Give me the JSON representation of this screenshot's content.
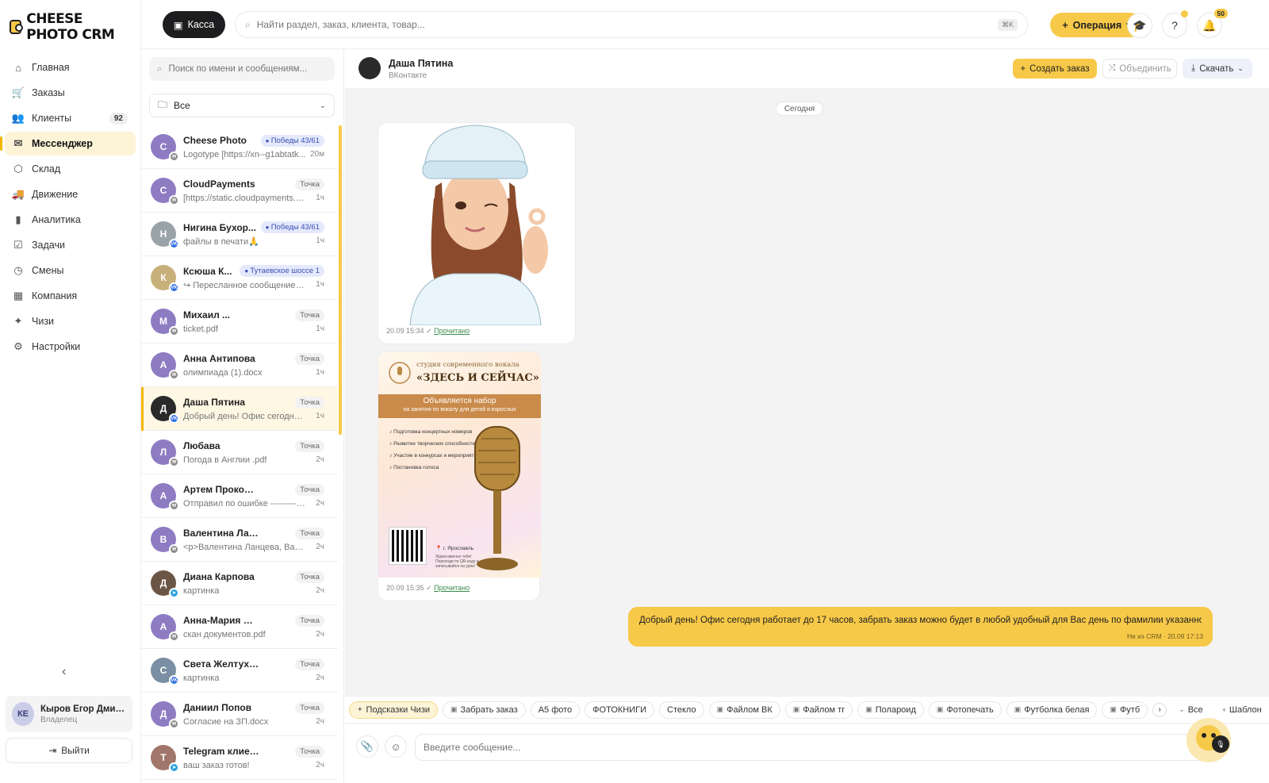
{
  "app": {
    "logo": "CHEESE PHOTO CRM"
  },
  "sidebar": {
    "items": [
      {
        "label": "Главная",
        "icon": "home-icon",
        "glyph": "⌂"
      },
      {
        "label": "Заказы",
        "icon": "cart-icon",
        "glyph": "🛒"
      },
      {
        "label": "Клиенты",
        "icon": "users-icon",
        "glyph": "👥",
        "badge": "92"
      },
      {
        "label": "Мессенджер",
        "icon": "mail-icon",
        "glyph": "✉",
        "active": true
      },
      {
        "label": "Склад",
        "icon": "box-icon",
        "glyph": "⬡"
      },
      {
        "label": "Движение",
        "icon": "truck-icon",
        "glyph": "🚚"
      },
      {
        "label": "Аналитика",
        "icon": "chart-icon",
        "glyph": "▮"
      },
      {
        "label": "Задачи",
        "icon": "clipboard-icon",
        "glyph": "☑"
      },
      {
        "label": "Смены",
        "icon": "clock-icon",
        "glyph": "◷"
      },
      {
        "label": "Компания",
        "icon": "building-icon",
        "glyph": "▦"
      },
      {
        "label": "Чизи",
        "icon": "sparkle-icon",
        "glyph": "✦"
      },
      {
        "label": "Настройки",
        "icon": "gear-icon",
        "glyph": "⚙"
      }
    ],
    "user": {
      "initials": "КЕ",
      "name": "Кыров Егор Дмитр...",
      "role": "Владелец"
    },
    "logout": "Выйти"
  },
  "topbar": {
    "kassa": "Касса",
    "search_placeholder": "Найти раздел, заказ, клиента, товар...",
    "shortcut": "⌘K",
    "operation": "Операция",
    "notifications": "50"
  },
  "chatlist": {
    "search_placeholder": "Поиск по имени и сообщениям...",
    "filter": "Все",
    "items": [
      {
        "initial": "C",
        "color": "#8e7cc3",
        "channel": "mail",
        "name": "Cheese Photo",
        "tag": "Победы 43/61",
        "tag_type": "blue",
        "preview": "Logotype [https://xn--g1abtatk...",
        "time": "20м"
      },
      {
        "initial": "C",
        "color": "#8e7cc3",
        "channel": "mail",
        "name": "CloudPayments",
        "tag": "Точка",
        "tag_type": "gray",
        "preview": "[https://static.cloudpayments.ru...",
        "time": "1ч"
      },
      {
        "initial": "Н",
        "color": "#9aa3a8",
        "channel": "vk",
        "name": "Нигина Бухор...",
        "tag": "Победы 43/61",
        "tag_type": "blue",
        "preview": "файлы в печати🙏",
        "time": "1ч"
      },
      {
        "initial": "К",
        "color": "#c8b07a",
        "channel": "vk",
        "name": "Ксюша К...",
        "tag": "Тутаевское шоссе 1",
        "tag_type": "blue",
        "preview": "↪ Пересланное сообщение: Д...",
        "time": "1ч"
      },
      {
        "initial": "М",
        "color": "#8e7cc3",
        "channel": "mail",
        "name": "Михаил ...",
        "tag": "Точка",
        "tag_type": "gray",
        "preview": "ticket.pdf",
        "time": "1ч"
      },
      {
        "initial": "А",
        "color": "#8e7cc3",
        "channel": "mail",
        "name": "Анна Антипова",
        "tag": "Точка",
        "tag_type": "gray",
        "preview": "олимпиада (1).docx",
        "time": "1ч"
      },
      {
        "initial": "Д",
        "color": "#2a2a2a",
        "channel": "vk",
        "name": "Даша Пятина",
        "tag": "Точка",
        "tag_type": "gray",
        "preview": "Добрый день! Офис сегодня ра...",
        "time": "1ч",
        "active": true
      },
      {
        "initial": "Л",
        "color": "#8e7cc3",
        "channel": "mail",
        "name": "Любава",
        "tag": "Точка",
        "tag_type": "gray",
        "preview": "Погода в Англии .pdf",
        "time": "2ч"
      },
      {
        "initial": "А",
        "color": "#8e7cc3",
        "channel": "mail",
        "name": "Артем Прокопенко",
        "tag": "Точка",
        "tag_type": "gray",
        "preview": "Отправил по ошибке --------- ...",
        "time": "2ч"
      },
      {
        "initial": "В",
        "color": "#8e7cc3",
        "channel": "mail",
        "name": "Валентина Ланцева",
        "tag": "Точка",
        "tag_type": "gray",
        "preview": "<p>Валентина Ланцева, Ваш за...",
        "time": "2ч"
      },
      {
        "initial": "Д",
        "color": "#6b5545",
        "channel": "tg",
        "name": "Диана Карпова",
        "tag": "Точка",
        "tag_type": "gray",
        "preview": "картинка",
        "time": "2ч"
      },
      {
        "initial": "А",
        "color": "#8e7cc3",
        "channel": "mail",
        "name": "Анна-Мария Абзали...",
        "tag": "Точка",
        "tag_type": "gray",
        "preview": "скан документов.pdf",
        "time": "2ч"
      },
      {
        "initial": "С",
        "color": "#7a8fa3",
        "channel": "vk",
        "name": "Света Желтухина",
        "tag": "Точка",
        "tag_type": "gray",
        "preview": "картинка",
        "time": "2ч"
      },
      {
        "initial": "Д",
        "color": "#8e7cc3",
        "channel": "mail",
        "name": "Даниил Попов",
        "tag": "Точка",
        "tag_type": "gray",
        "preview": "Согласие на ЗП.docx",
        "time": "2ч"
      },
      {
        "initial": "T",
        "color": "#a0776a",
        "channel": "tg",
        "name": "Telegram клиент",
        "tag": "Точка",
        "tag_type": "gray",
        "preview": "ваш заказ готов!",
        "time": "2ч"
      }
    ]
  },
  "chat": {
    "contact_name": "Даша Пятина",
    "contact_source": "ВКонтакте",
    "create_order": "Создать заказ",
    "merge": "Объединить",
    "download": "Скачать",
    "date_label": "Сегодня",
    "msg1": {
      "time": "20.09 15:34",
      "status": "Прочитано"
    },
    "msg2": {
      "time": "20.09 15:35",
      "status": "Прочитано"
    },
    "poster": {
      "line1": "студия современного вокала",
      "line2": "«ЗДЕСЬ И СЕЙЧАС»",
      "band1": "Объявляется набор",
      "band2": "на занятия по вокалу для детей и взрослых",
      "list": [
        "Подготовка концертных номеров",
        "Развитие творческих способностей",
        "Участие в конкурсах и мероприятиях",
        "Постановка голоса"
      ],
      "city": "г. Ярославль",
      "call": "Ждем именно тебя! Переходи по QR-коду и записывайся на урок!"
    },
    "outgoing": {
      "text": "Добрый день! Офис сегодня работает до 17 часов, забрать заказ можно будет в любой удобный для Вас день по фамилии указанной ВК🙏",
      "meta": "Не из CRM · 20.09 17:13"
    },
    "chips": [
      "Подсказки Чизи",
      "Забрать заказ",
      "А5 фото",
      "ФОТОКНИГИ",
      "Стекло",
      "Файлом ВК",
      "Файлом тг",
      "Полароид",
      "Фотопечать",
      "Футболка белая",
      "Футб"
    ],
    "chips_all": "Все",
    "chips_template": "Шаблон",
    "composer_placeholder": "Введите сообщение..."
  },
  "colors": {
    "accent": "#f7c948",
    "vk": "#2f6fe4",
    "tg": "#2aa3df",
    "mail": "#8a8a8a"
  }
}
